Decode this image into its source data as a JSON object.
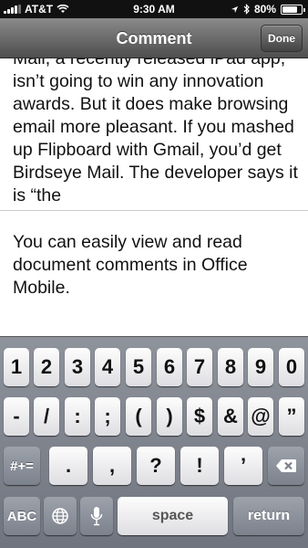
{
  "status_bar": {
    "carrier": "AT&T",
    "time": "9:30 AM",
    "battery": "80%",
    "battery_level": 0.8,
    "icons": [
      "signal-icon",
      "wifi-icon",
      "location-icon",
      "bluetooth-icon",
      "battery-icon"
    ]
  },
  "nav": {
    "title": "Comment",
    "done_label": "Done"
  },
  "article": {
    "text": "Mail, a recently released iPad app, isn’t going to win any innovation awards. But it does make browsing email more pleasant. If you mashed up Flipboard with Gmail, you’d get Birdseye Mail. The developer says it is “the"
  },
  "comment": {
    "text": "You can easily view and read document comments in Office Mobile."
  },
  "keyboard": {
    "row1": [
      "1",
      "2",
      "3",
      "4",
      "5",
      "6",
      "7",
      "8",
      "9",
      "0"
    ],
    "row2": [
      "-",
      "/",
      ":",
      ";",
      "(",
      ")",
      "$",
      "&",
      "@",
      "”"
    ],
    "row3": {
      "shift_label": "#+=",
      "keys": [
        ".",
        ",",
        "?",
        "!",
        "’"
      ],
      "delete_icon": "backspace-icon"
    },
    "row4": {
      "abc_label": "ABC",
      "globe_icon": "globe-icon",
      "mic_icon": "microphone-icon",
      "space_label": "space",
      "return_label": "return"
    }
  }
}
